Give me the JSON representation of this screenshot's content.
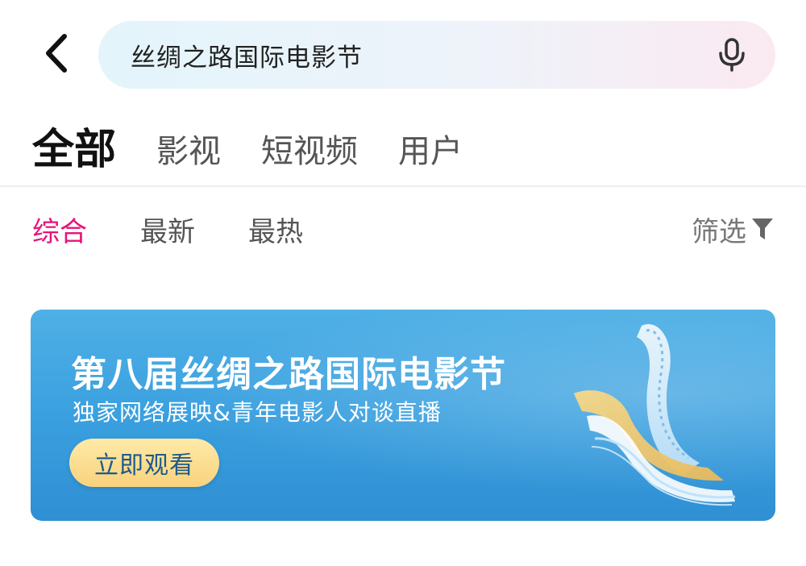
{
  "search": {
    "query": "丝绸之路国际电影节"
  },
  "tabs": [
    {
      "label": "全部",
      "active": true
    },
    {
      "label": "影视",
      "active": false
    },
    {
      "label": "短视频",
      "active": false
    },
    {
      "label": "用户",
      "active": false
    }
  ],
  "sort_tabs": [
    {
      "label": "综合",
      "active": true
    },
    {
      "label": "最新",
      "active": false
    },
    {
      "label": "最热",
      "active": false
    }
  ],
  "filter": {
    "label": "筛选"
  },
  "banner": {
    "title": "第八届丝绸之路国际电影节",
    "subtitle": "独家网络展映&青年电影人对谈直播",
    "button_label": "立即观看"
  },
  "colors": {
    "accent": "#e5157a",
    "banner_bg": "#3aa0df",
    "button_bg": "#f8d27c"
  },
  "icons": {
    "back": "chevron-left-icon",
    "mic": "microphone-icon",
    "filter": "funnel-icon"
  }
}
